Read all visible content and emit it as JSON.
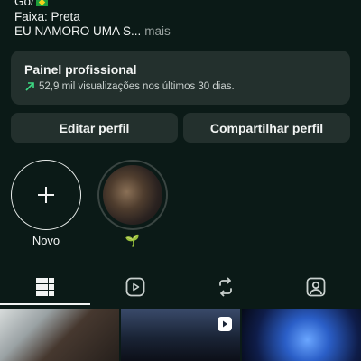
{
  "bio": {
    "line1": "Go/",
    "line2": "Faixa: Preta",
    "line3": "EU NAMORO UMA S...",
    "more_label": "mais"
  },
  "panel": {
    "title": "Painel profissional",
    "subtitle": "52,9 mil visualizações nos últimos 30 dias.",
    "arrow_color": "#3ddc84"
  },
  "buttons": {
    "edit_label": "Editar perfil",
    "share_label": "Compartilhar perfil"
  },
  "highlights": [
    {
      "label": "Novo",
      "icon": "plus-icon"
    },
    {
      "label": "🌱",
      "icon": "story-cover"
    }
  ],
  "tabs": [
    {
      "icon": "grid-icon",
      "active": true
    },
    {
      "icon": "reels-icon",
      "active": false
    },
    {
      "icon": "repost-icon",
      "active": false
    },
    {
      "icon": "tagged-icon",
      "active": false
    }
  ],
  "colors": {
    "background": "#0b1a17",
    "surface": "#23302d",
    "accent_green": "#3ddc84"
  }
}
